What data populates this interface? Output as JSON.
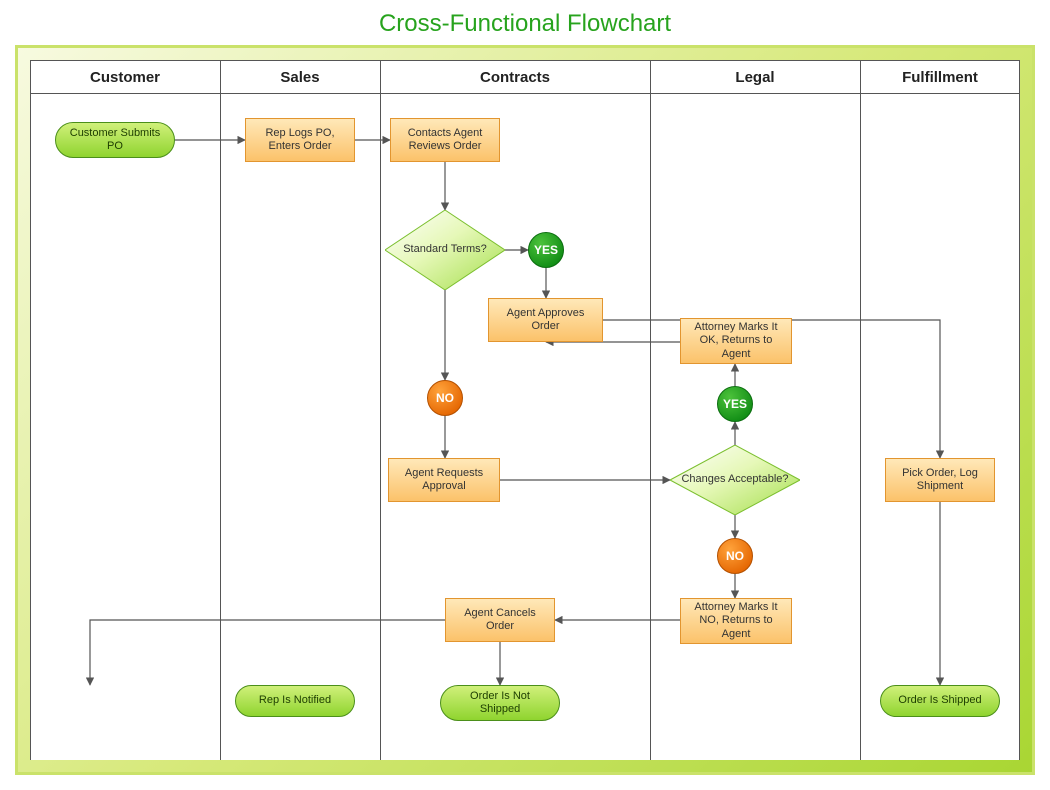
{
  "title": "Cross-Functional Flowchart",
  "lanes": {
    "customer": "Customer",
    "sales": "Sales",
    "contracts": "Contracts",
    "legal": "Legal",
    "fulfillment": "Fulfillment"
  },
  "nodes": {
    "customer_submits": "Customer Submits PO",
    "rep_logs": "Rep Logs PO, Enters Order",
    "contacts_agent": "Contacts Agent Reviews Order",
    "standard_terms": "Standard Terms?",
    "agent_approves": "Agent Approves Order",
    "agent_requests": "Agent Requests Approval",
    "agent_cancels": "Agent Cancels Order",
    "attorney_ok": "Attorney Marks It OK, Returns to Agent",
    "changes_acceptable": "Changes Acceptable?",
    "attorney_no": "Attorney Marks It NO, Returns to Agent",
    "pick_order": "Pick Order, Log Shipment",
    "rep_notified": "Rep Is Notified",
    "order_not_shipped": "Order Is Not Shipped",
    "order_shipped": "Order Is Shipped"
  },
  "labels": {
    "yes": "YES",
    "no": "NO"
  }
}
